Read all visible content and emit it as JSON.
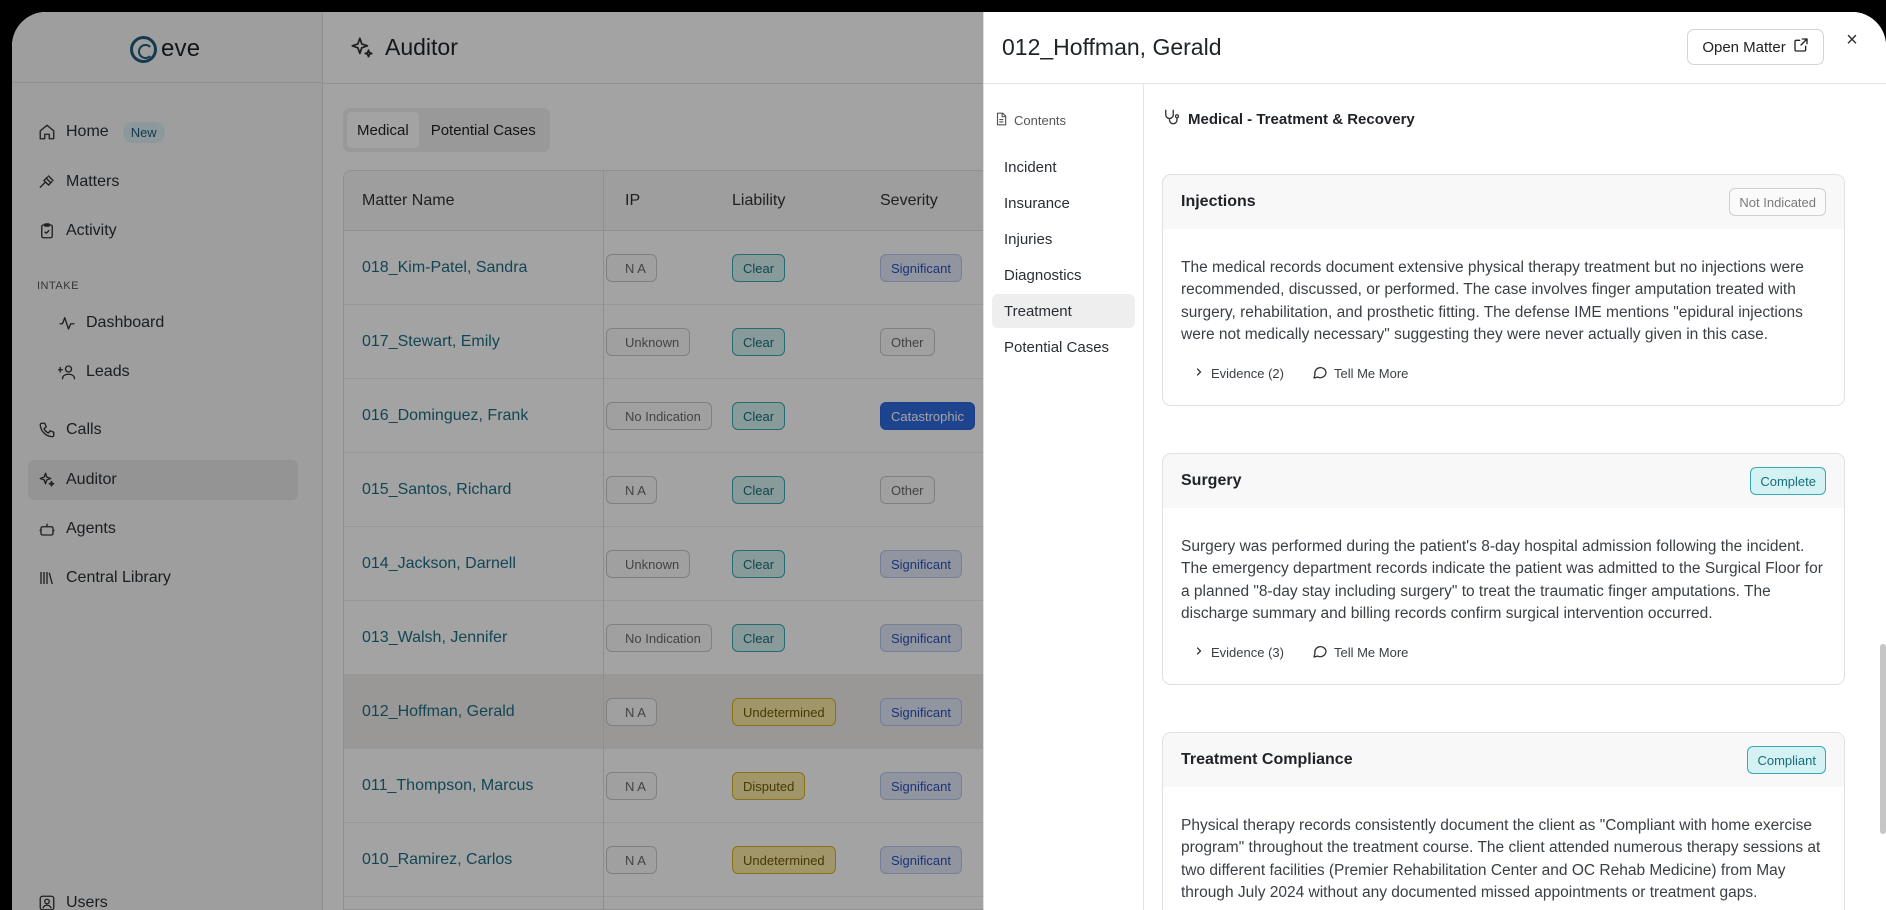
{
  "app": {
    "logo_text": "eve"
  },
  "sidebar": {
    "items": [
      {
        "label": "Home",
        "badge": "New",
        "icon": "home-icon"
      },
      {
        "label": "Matters",
        "icon": "gavel-icon"
      },
      {
        "label": "Activity",
        "icon": "clipboard-icon"
      },
      {
        "label": "Dashboard",
        "icon": "activity-icon"
      },
      {
        "label": "Leads",
        "icon": "user-plus-icon"
      },
      {
        "label": "Calls",
        "icon": "phone-icon"
      },
      {
        "label": "Auditor",
        "icon": "sparkles-icon",
        "active": true
      },
      {
        "label": "Agents",
        "icon": "bot-icon"
      },
      {
        "label": "Central Library",
        "icon": "library-icon"
      },
      {
        "label": "Users",
        "icon": "user-square-icon"
      }
    ],
    "section_intake": "INTAKE"
  },
  "main": {
    "title": "Auditor",
    "tabs": [
      "Medical",
      "Potential Cases"
    ],
    "columns": [
      "Matter Name",
      "IP",
      "Liability",
      "Severity"
    ],
    "rows": [
      {
        "name": "018_Kim-Patel, Sandra",
        "ip": "N A",
        "liability": "Clear",
        "severity": "Significant"
      },
      {
        "name": "017_Stewart, Emily",
        "ip": "Unknown",
        "liability": "Clear",
        "severity": "Other"
      },
      {
        "name": "016_Dominguez, Frank",
        "ip": "No Indication",
        "liability": "Clear",
        "severity": "Catastrophic"
      },
      {
        "name": "015_Santos, Richard",
        "ip": "N A",
        "liability": "Clear",
        "severity": "Other"
      },
      {
        "name": "014_Jackson, Darnell",
        "ip": "Unknown",
        "liability": "Clear",
        "severity": "Significant"
      },
      {
        "name": "013_Walsh, Jennifer",
        "ip": "No Indication",
        "liability": "Clear",
        "severity": "Significant"
      },
      {
        "name": "012_Hoffman, Gerald",
        "ip": "N A",
        "liability": "Undetermined",
        "severity": "Significant"
      },
      {
        "name": "011_Thompson, Marcus",
        "ip": "N A",
        "liability": "Disputed",
        "severity": "Significant"
      },
      {
        "name": "010_Ramirez, Carlos",
        "ip": "N A",
        "liability": "Undetermined",
        "severity": "Significant"
      }
    ]
  },
  "drawer": {
    "title": "012_Hoffman, Gerald",
    "open_matter": "Open Matter",
    "close": "×",
    "toc_heading": "Contents",
    "toc": [
      "Incident",
      "Insurance",
      "Injuries",
      "Diagnostics",
      "Treatment",
      "Potential Cases"
    ],
    "section_title": "Medical - Treatment & Recovery",
    "cards": [
      {
        "title": "Injections",
        "status": "Not Indicated",
        "body": "The medical records document extensive physical therapy treatment but no injections were recommended, discussed, or performed. The case involves finger amputation treated with surgery, rehabilitation, and prosthetic fitting. The defense IME mentions \"epidural injections were not medically necessary\" suggesting they were never actually given in this case.",
        "evidence": "Evidence (2)",
        "tell_more": "Tell Me More"
      },
      {
        "title": "Surgery",
        "status": "Complete",
        "body": "Surgery was performed during the patient's 8-day hospital admission following the incident. The emergency department records indicate the patient was admitted to the Surgical Floor for a planned \"8-day stay including surgery\" to treat the traumatic finger amputations. The discharge summary and billing records confirm surgical intervention occurred.",
        "evidence": "Evidence (3)",
        "tell_more": "Tell Me More"
      },
      {
        "title": "Treatment Compliance",
        "status": "Compliant",
        "body": "Physical therapy records consistently document the client as \"Compliant with home exercise program\" throughout the treatment course. The client attended numerous therapy sessions at two different facilities (Premier Rehabilitation Center and OC Rehab Medicine) from May through July 2024 without any documented missed appointments or treatment gaps.",
        "evidence": "",
        "tell_more": ""
      }
    ]
  },
  "colors": {
    "accent": "#1e6e86",
    "clear": "#3aa8b3",
    "catastrophic": "#2f6ae0",
    "undetermined": "#d9b21f"
  }
}
